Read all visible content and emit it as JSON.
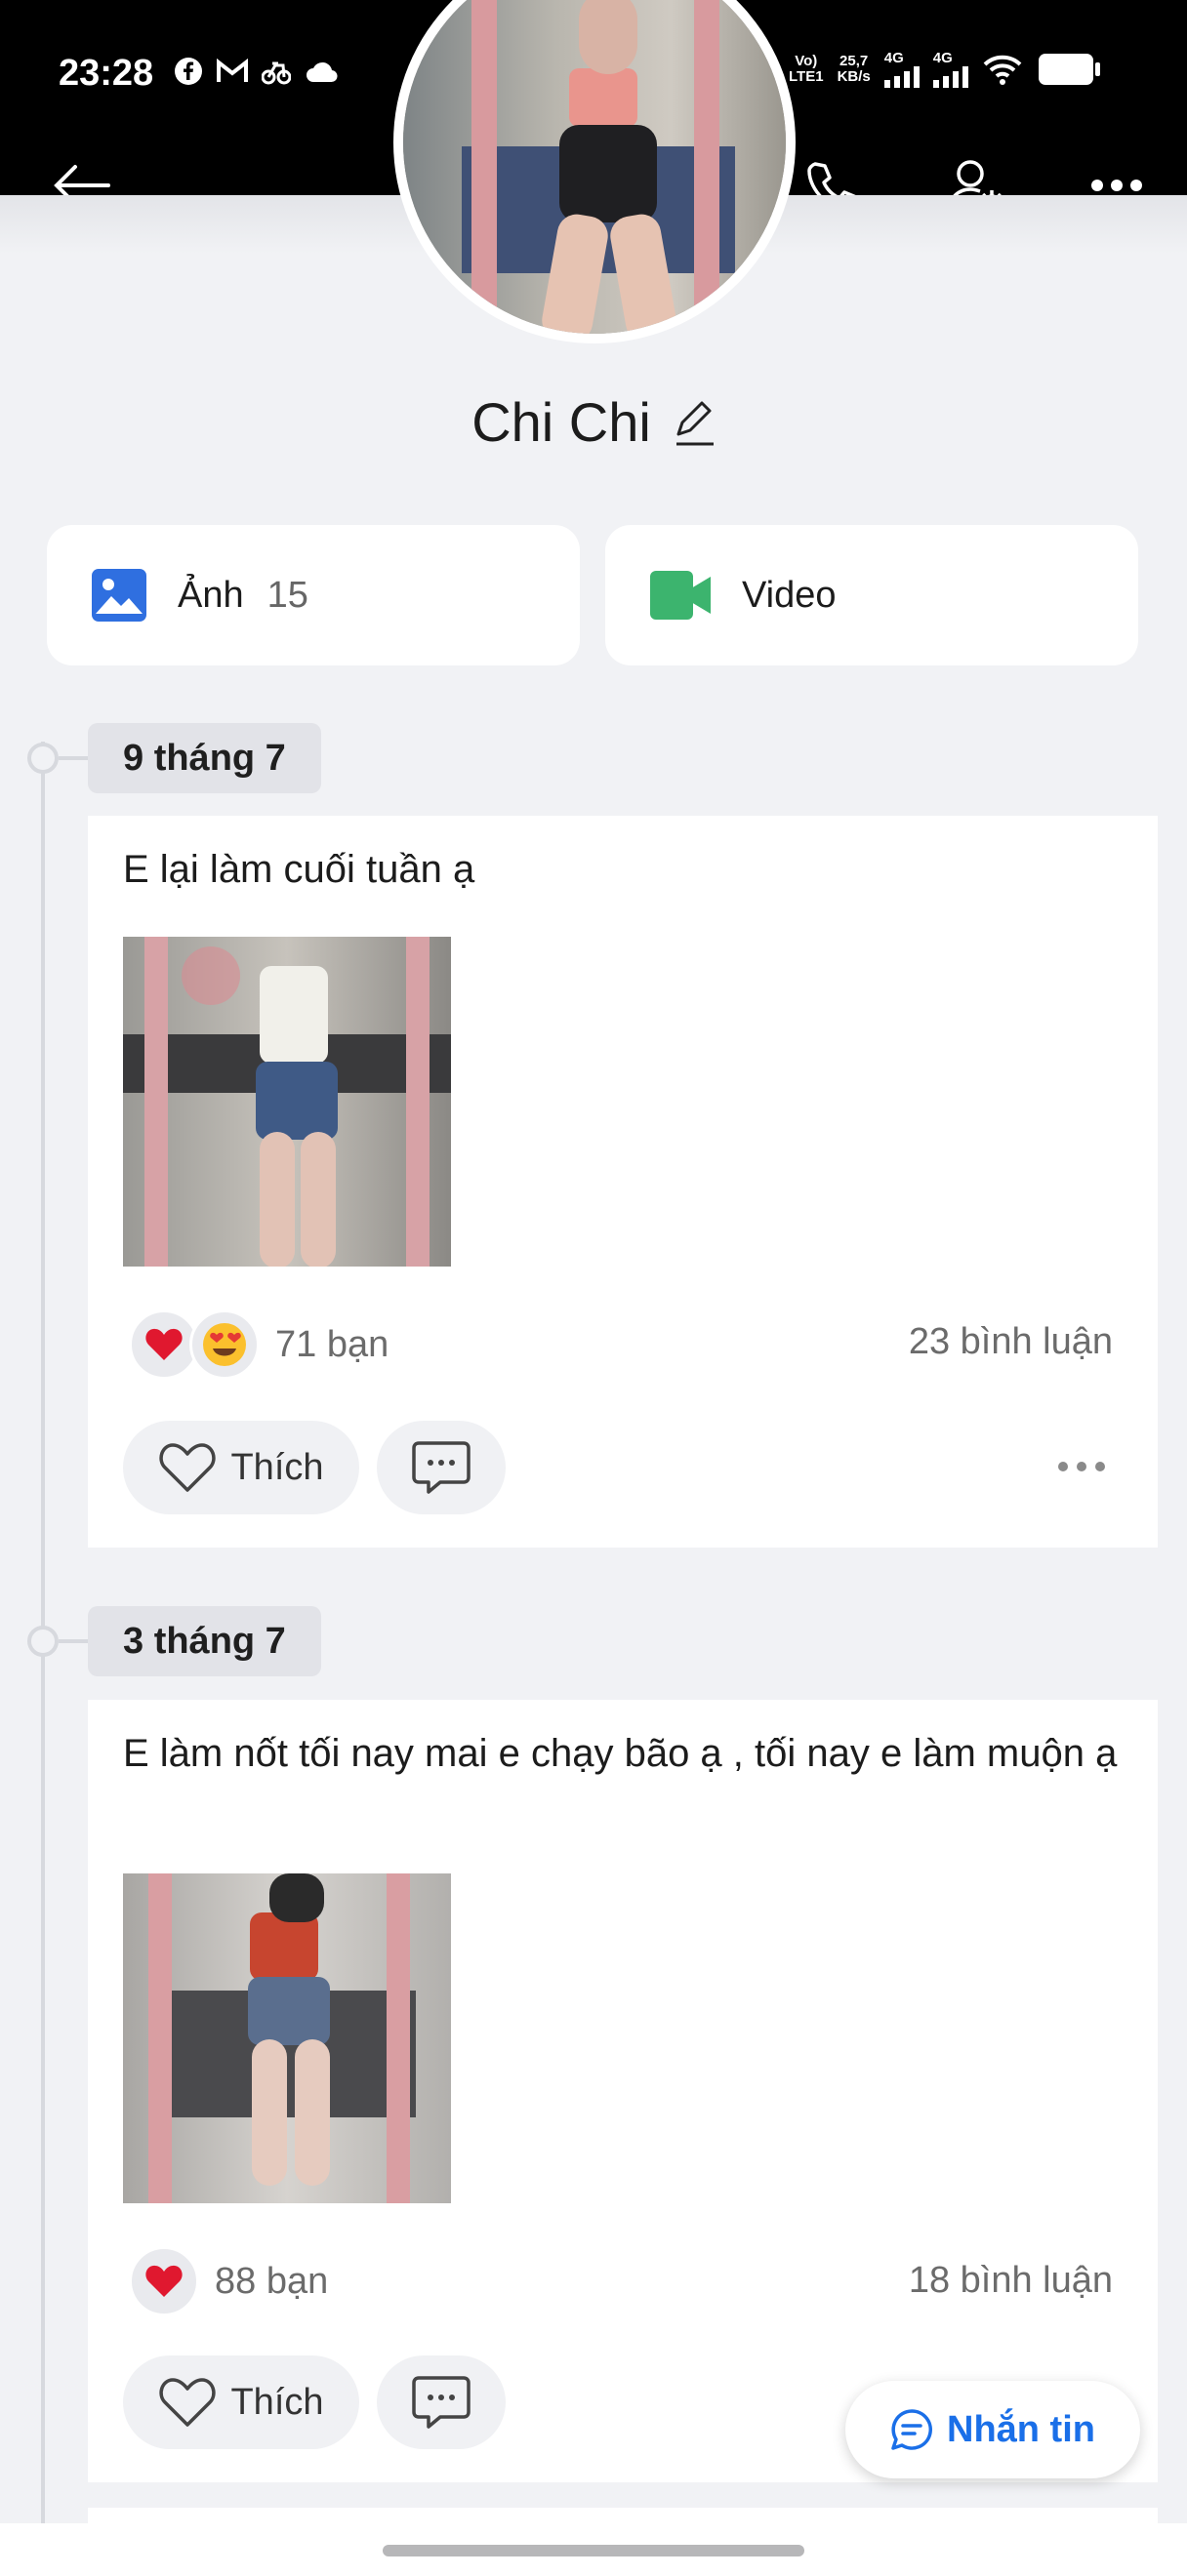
{
  "status_bar": {
    "time": "23:28",
    "lte_top": "Vo)",
    "lte_bottom": "LTE1",
    "speed_top": "25,7",
    "speed_bottom": "KB/s",
    "net1": "4G",
    "net2": "4G",
    "icons": [
      "facebook-icon",
      "gmail-icon",
      "bike-icon",
      "cloud-icon",
      "nfc-icon",
      "alarm-icon",
      "signal-icon",
      "wifi-icon",
      "battery-icon"
    ]
  },
  "header": {
    "back_icon": "back-arrow-icon",
    "call_icon": "phone-icon",
    "settings_icon": "user-settings-icon",
    "more_icon": "more-dots-icon"
  },
  "profile": {
    "name": "Chi Chi",
    "edit_icon": "pencil-icon"
  },
  "media": {
    "photos_label": "Ảnh",
    "photos_count": "15",
    "video_label": "Video"
  },
  "posts": [
    {
      "date": "9 tháng 7",
      "text": "E lại làm cuối tuần ạ",
      "reactions": "71 bạn",
      "comments": "23 bình luận",
      "like_label": "Thích"
    },
    {
      "date": "3 tháng 7",
      "text": "E làm nốt tối nay mai e chạy bão ạ , tối nay e làm muộn ạ",
      "reactions": "88 bạn",
      "comments": "18 bình luận",
      "like_label": "Thích"
    }
  ],
  "fab": {
    "label": "Nhắn tin"
  },
  "colors": {
    "accent": "#1a6fe8",
    "photo_icon": "#2f6fe0",
    "video_icon": "#3cb46e",
    "background": "#f1f2f5"
  }
}
